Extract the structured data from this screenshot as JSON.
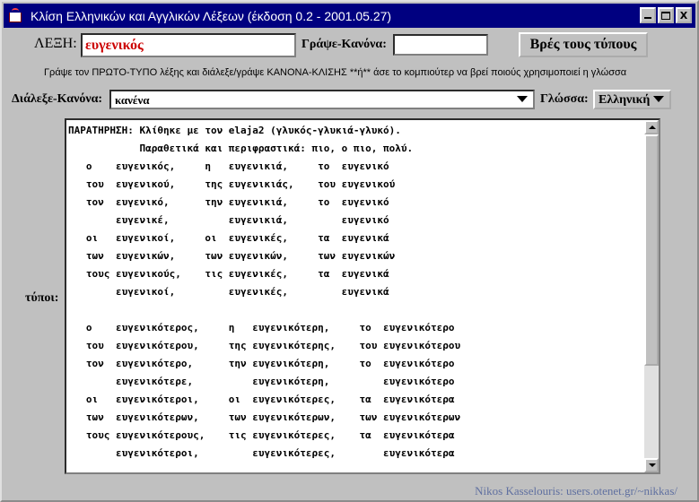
{
  "window": {
    "title": "Κλίση Ελληνικών και Αγγλικών Λέξεων (έκδοση 0.2 - 2001.05.27)",
    "close_label": "X"
  },
  "form": {
    "word_label": "ΛΕΞΗ:",
    "word_value": "ευγενικός",
    "rule_label": "Γράψε-Κανόνα:",
    "rule_value": "",
    "find_button": "Βρές τους τύπους",
    "hint": "Γράψε τον ΠΡΩΤΟ-ΤΥΠΟ λέξης και διάλεξε/γράψε ΚΑΝΟΝΑ-ΚΛΙΣΗΣ **ή** άσε το κομπιούτερ να βρεί ποιούς χρησιμοποιεί η γλώσσα",
    "choose_rule_label": "Διάλεξε-Κανόνα:",
    "choose_rule_value": "κανένα",
    "language_label": "Γλώσσα:",
    "language_value": "Ελληνική",
    "forms_label": "τύποι:"
  },
  "output_lines": [
    "ΠΑΡΑΤΗΡΗΣΗ: Κλίθηκε με τον elaja2 (γλυκός-γλυκιά-γλυκό).",
    "            Παραθετικά και περιφραστικά: πιο, ο πιο, πολύ.",
    "   ο    ευγενικός,     η   ευγενικιά,     το  ευγενικό",
    "   του  ευγενικού,     της ευγενικιάς,    του ευγενικού",
    "   τον  ευγενικό,      την ευγενικιά,     το  ευγενικό",
    "        ευγενικέ,          ευγενικιά,         ευγενικό",
    "   οι   ευγενικοί,     οι  ευγενικές,     τα  ευγενικά",
    "   των  ευγενικών,     των ευγενικών,     των ευγενικών",
    "   τους ευγενικούς,    τις ευγενικές,     τα  ευγενικά",
    "        ευγενικοί,         ευγενικές,         ευγενικά",
    "",
    "   ο    ευγενικότερος,     η   ευγενικότερη,     το  ευγενικότερο",
    "   του  ευγενικότερου,     της ευγενικότερης,    του ευγενικότερου",
    "   τον  ευγενικότερο,      την ευγενικότερη,     το  ευγενικότερο",
    "        ευγενικότερε,          ευγενικότερη,         ευγενικότερο",
    "   οι   ευγενικότεροι,     οι  ευγενικότερες,    τα  ευγενικότερα",
    "   των  ευγενικότερων,     των ευγενικότερων,    των ευγενικότερων",
    "   τους ευγενικότερους,    τις ευγενικότερες,    τα  ευγενικότερα",
    "        ευγενικότεροι,         ευγενικότερες,        ευγενικότερα"
  ],
  "credit": "Nikos Kasselouris: users.otenet.gr/~nikkas/",
  "colors": {
    "titlebar": "#000080",
    "word_text": "#cc0000",
    "credit_text": "#6070a0"
  },
  "icons": {
    "app": "java-cup-icon",
    "minimize": "minimize-icon",
    "maximize": "maximize-icon",
    "close": "close-icon",
    "dropdown": "chevron-down-icon"
  }
}
